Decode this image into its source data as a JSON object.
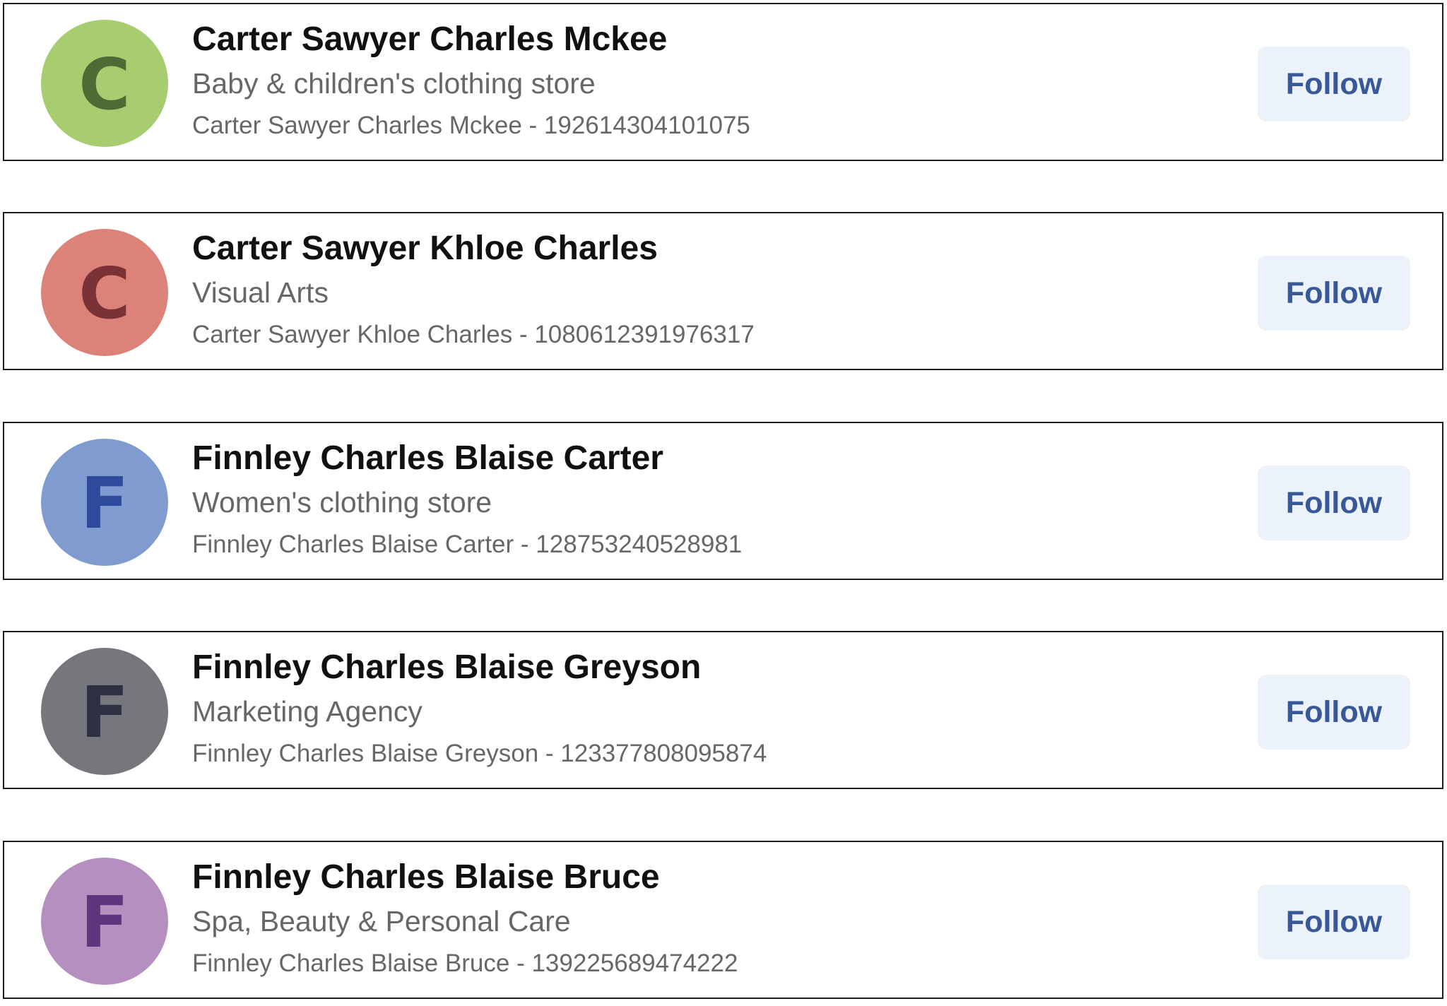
{
  "colors": {
    "card_border": "#1c1c1c",
    "name_text": "#111111",
    "secondary_text": "#65676b",
    "follow_button_bg": "#ebf2fa",
    "follow_button_text": "#385898"
  },
  "pages": [
    {
      "avatar_letter": "C",
      "avatar_bg": "#a8cd71",
      "avatar_fg": "#4d6b35",
      "name": "Carter Sawyer Charles Mckee",
      "category": "Baby & children's clothing store",
      "subtitle": "Carter Sawyer Charles Mckee - 192614304101075",
      "follow_label": "Follow"
    },
    {
      "avatar_letter": "C",
      "avatar_bg": "#dc8279",
      "avatar_fg": "#7a3236",
      "name": "Carter Sawyer Khloe Charles",
      "category": "Visual Arts",
      "subtitle": "Carter Sawyer Khloe Charles - 1080612391976317",
      "follow_label": "Follow"
    },
    {
      "avatar_letter": "F",
      "avatar_bg": "#7f9bd0",
      "avatar_fg": "#2e4a9c",
      "name": "Finnley Charles Blaise Carter",
      "category": "Women's clothing store",
      "subtitle": "Finnley Charles Blaise Carter - 128753240528981",
      "follow_label": "Follow"
    },
    {
      "avatar_letter": "F",
      "avatar_bg": "#75777c",
      "avatar_fg": "#2c3042",
      "name": "Finnley Charles Blaise Greyson",
      "category": "Marketing Agency",
      "subtitle": "Finnley Charles Blaise Greyson - 123377808095874",
      "follow_label": "Follow"
    },
    {
      "avatar_letter": "F",
      "avatar_bg": "#b48fc0",
      "avatar_fg": "#5f357d",
      "name": "Finnley Charles Blaise Bruce",
      "category": "Spa, Beauty & Personal Care",
      "subtitle": "Finnley Charles Blaise Bruce - 139225689474222",
      "follow_label": "Follow"
    }
  ]
}
